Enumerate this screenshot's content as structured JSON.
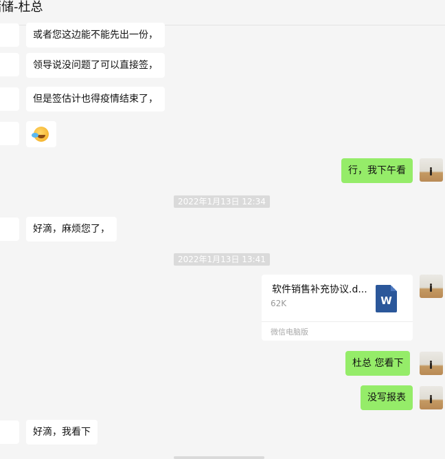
{
  "header": {
    "title": "储储-杜总"
  },
  "messages": {
    "m1": "或者您这边能不能先出一份，",
    "m2": "领导说没问题了可以直接签，",
    "m3": "但是签估计也得疫情结束了，",
    "m4_emoji": "laughing-tears-emoji",
    "m5": "行，我下午看",
    "t1": "2022年1月13日 12:34",
    "m6": "好滴，麻烦您了，",
    "t2": "2022年1月13日 13:41",
    "file": {
      "name": "软件销售补充协议.d...",
      "size": "62K",
      "source": "微信电脑版",
      "icon": "word-icon",
      "icon_letter": "W"
    },
    "m7": "杜总  您看下",
    "m8": "没写报表",
    "m9": "好滴，我看下"
  },
  "colors": {
    "background": "#f5f5f5",
    "outgoing_bubble": "#95ec69",
    "incoming_bubble": "#ffffff",
    "timestamp_bg": "#dadada",
    "word_blue": "#2b579a"
  }
}
